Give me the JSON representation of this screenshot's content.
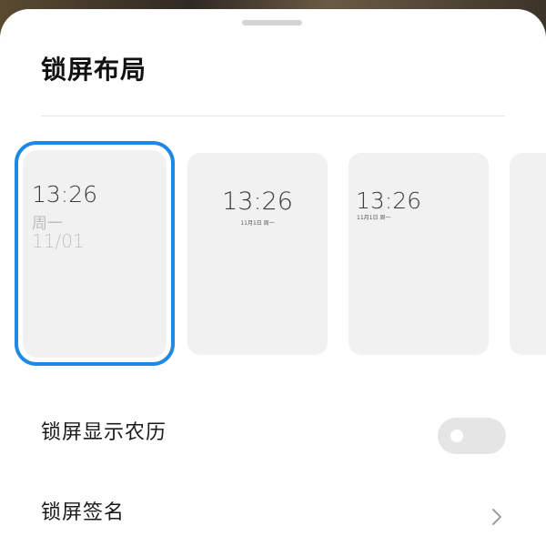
{
  "sheet": {
    "title": "锁屏布局"
  },
  "layouts": [
    {
      "time": "13:26",
      "weekday": "周一",
      "date": "11/01",
      "selected": true
    },
    {
      "time": "13:26",
      "subtitle": "11月1日 周一",
      "selected": false
    },
    {
      "time": "13:26",
      "subtitle": "11月1日 周一",
      "selected": false
    }
  ],
  "settings": {
    "lunar_label": "锁屏显示农历",
    "lunar_enabled": false,
    "signature_label": "锁屏签名"
  },
  "colors": {
    "accent": "#1e88e5",
    "card_bg": "#f1f1f1",
    "toggle_off": "#e5e5e5"
  },
  "icons": {
    "toggle": "toggle-switch-icon",
    "chevron": "chevron-right-icon"
  }
}
